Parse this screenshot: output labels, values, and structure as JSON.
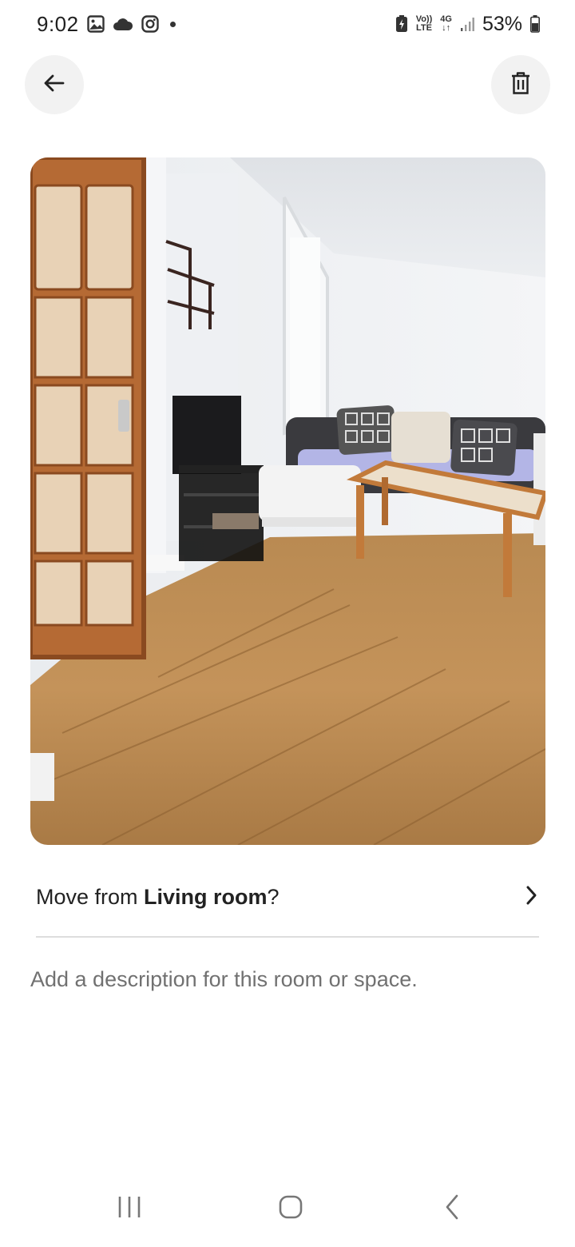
{
  "status_bar": {
    "time": "9:02",
    "left_icons": [
      "gallery-icon",
      "cloud-icon",
      "instagram-icon",
      "notification-dot"
    ],
    "network_line1": "Vo))",
    "network_line2": "LTE",
    "data_line1": "4G",
    "data_line2": "↓↑",
    "battery_percent": "53%"
  },
  "header": {
    "back_icon": "arrow-left-icon",
    "delete_icon": "trash-icon"
  },
  "photo": {
    "subject": "living-room-photo"
  },
  "move": {
    "prefix": "Move from ",
    "room": "Living room",
    "suffix": "?",
    "chevron_icon": "chevron-right-icon"
  },
  "description": {
    "placeholder": "Add a description for this room or space."
  },
  "nav_bar": {
    "recents_icon": "recents-icon",
    "home_icon": "home-icon",
    "back_icon": "back-chevron-icon"
  },
  "colors": {
    "background": "#ffffff",
    "button_bg": "#f2f2f2",
    "text_primary": "#222222",
    "text_secondary": "#717171",
    "divider": "#dddddd"
  }
}
